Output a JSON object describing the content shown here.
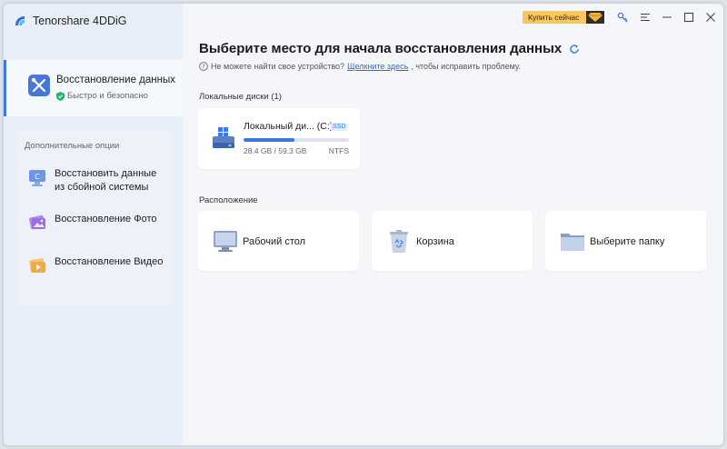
{
  "app": {
    "name": "Tenorshare 4DDiG"
  },
  "titlebar": {
    "buy_label": "Купить сейчас"
  },
  "sidebar": {
    "primary": {
      "title": "Восстановление данных",
      "subtitle": "Быстро и безопасно"
    },
    "extra_title": "Дополнительные опции",
    "extra_items": [
      {
        "label": "Восстановить данные из сбойной системы",
        "icon": "system-crash-icon"
      },
      {
        "label": "Восстановление Фото",
        "icon": "photo-icon"
      },
      {
        "label": "Восстановление Видео",
        "icon": "video-icon"
      }
    ]
  },
  "main": {
    "title": "Выберите место для начала восстановления данных",
    "hint_prefix": "Не можете найти свое устройство?",
    "hint_link": "Щелкните здесь",
    "hint_suffix": ", чтобы исправить проблему.",
    "local_disks_label": "Локальные диски (1)",
    "disk": {
      "name": "Локальный ди... (C:)",
      "badge": "SSD",
      "size_text": "28.4 GB / 59.3 GB",
      "fs": "NTFS",
      "used_fraction": 0.479
    },
    "location_label": "Расположение",
    "locations": [
      {
        "label": "Рабочий стол",
        "icon": "desktop-icon"
      },
      {
        "label": "Корзина",
        "icon": "recycle-bin-icon"
      },
      {
        "label": "Выберите папку",
        "icon": "folder-icon"
      }
    ]
  },
  "colors": {
    "accent": "#3e76e4",
    "buy": "#f8c760"
  }
}
